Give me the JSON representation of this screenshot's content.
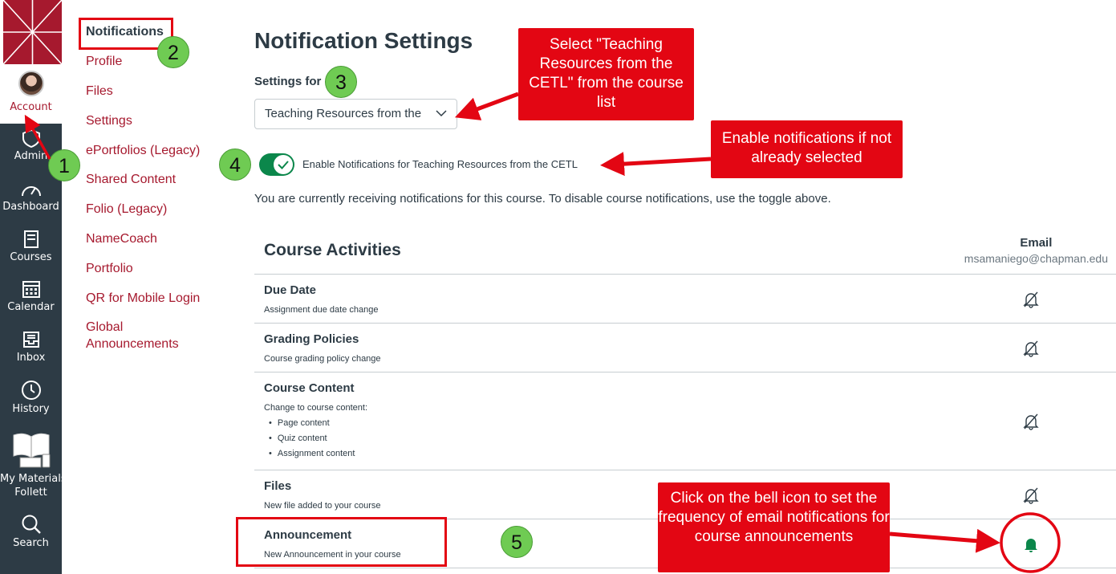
{
  "global_nav": {
    "account_label": "Account",
    "items": [
      {
        "label": "Admin",
        "icon": "shield-icon"
      },
      {
        "label": "Dashboard",
        "icon": "dashboard-icon"
      },
      {
        "label": "Courses",
        "icon": "courses-icon"
      },
      {
        "label": "Calendar",
        "icon": "calendar-icon"
      },
      {
        "label": "Inbox",
        "icon": "inbox-icon"
      },
      {
        "label": "History",
        "icon": "clock-icon"
      },
      {
        "label": "My Materials",
        "label2": "Follett",
        "icon": "book-devices-icon"
      },
      {
        "label": "Search",
        "icon": "search-icon"
      }
    ]
  },
  "sub_nav": {
    "items": [
      "Notifications",
      "Profile",
      "Files",
      "Settings",
      "ePortfolios (Legacy)",
      "Shared Content",
      "Folio (Legacy)",
      "NameCoach",
      "Portfolio",
      "QR for Mobile Login",
      "Global",
      "Announcements"
    ]
  },
  "main": {
    "title": "Notification Settings",
    "settings_for_label": "Settings for",
    "course_select_value": "Teaching Resources from the",
    "toggle_label": "Enable Notifications for Teaching Resources from the CETL",
    "toggle_on": true,
    "info_text": "You are currently receiving notifications for this course. To disable course notifications, use the toggle above.",
    "section_title": "Course Activities",
    "email_header": "Email",
    "email_address": "msamaniego@chapman.edu",
    "rows": [
      {
        "name": "Due Date",
        "desc": "Assignment due date change",
        "bell": "bell-off-icon"
      },
      {
        "name": "Grading Policies",
        "desc": "Course grading policy change",
        "bell": "bell-off-icon"
      },
      {
        "name": "Course Content",
        "desc": "Change to course content:",
        "bullets": [
          "Page content",
          "Quiz content",
          "Assignment content"
        ],
        "bell": "bell-off-icon"
      },
      {
        "name": "Files",
        "desc": "New file added to your course",
        "bell": "bell-off-icon"
      },
      {
        "name": "Announcement",
        "desc": "New Announcement in your course",
        "bell": "bell-icon"
      }
    ]
  },
  "annotations": {
    "callout_select": "Select \"Teaching Resources from the CETL\" from the course list",
    "callout_enable": "Enable notifications if not already selected",
    "callout_bell": "Click on the bell icon to set the frequency of email notifications for course announcements",
    "steps": [
      "1",
      "2",
      "3",
      "4",
      "5"
    ],
    "accent_color": "#e30613",
    "step_color": "#6fcb53"
  },
  "colors": {
    "brand": "#a6192e",
    "nav_bg": "#2d3b45",
    "toggle_on": "#0b874b",
    "bell_active": "#0b874b"
  }
}
